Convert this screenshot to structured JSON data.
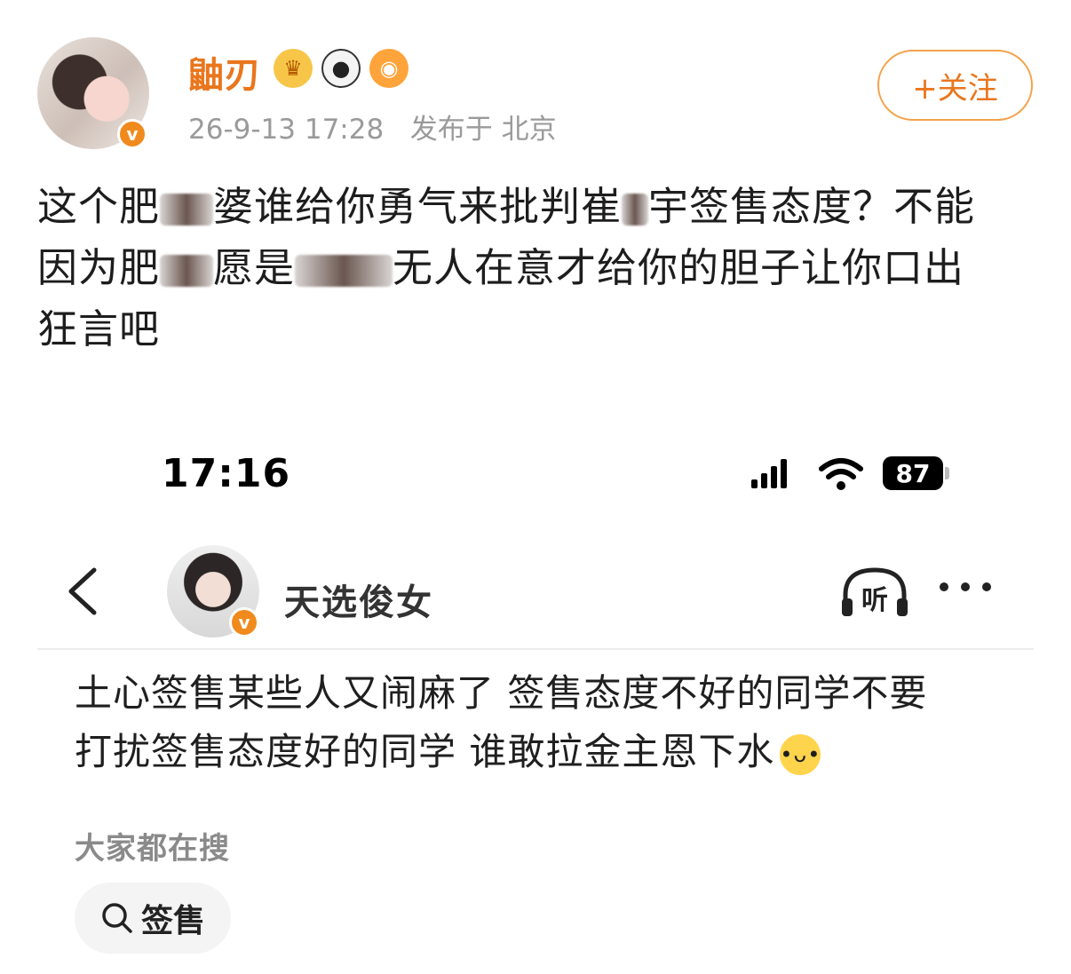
{
  "post": {
    "username": "鼬刃",
    "verified_mark": "v",
    "timestamp": "26-9-13 17:28",
    "location_text": "发布于 北京",
    "follow_label": "+关注",
    "text_line1_a": "这个肥",
    "text_line1_b": "婆谁给你勇气来批判崔",
    "text_line1_c": "宇签售态度？不能",
    "text_line2_a": "因为肥",
    "text_line2_b": "愿是",
    "text_line2_c": "无人在意才给你的胆子让你口出",
    "text_line3": "狂言吧"
  },
  "embedded": {
    "status_time": "17:16",
    "battery": "87",
    "username": "天选俊女",
    "verified_mark": "v",
    "listen_label": "听",
    "text_line1": "土心签售某些人又闹麻了 签售态度不好的同学不要",
    "text_line2": "打扰签售态度好的同学 谁敢拉金主恩下水",
    "search_caption": "大家都在搜",
    "search_chip_label": "签售"
  },
  "colors": {
    "accent": "#e9761d",
    "verified": "#f08a1c"
  },
  "icons": [
    "crown-badge-icon",
    "panda-badge-icon",
    "fish-badge-icon",
    "back-arrow-icon",
    "headphones-icon",
    "more-icon",
    "search-icon",
    "signal-icon",
    "wifi-icon"
  ]
}
